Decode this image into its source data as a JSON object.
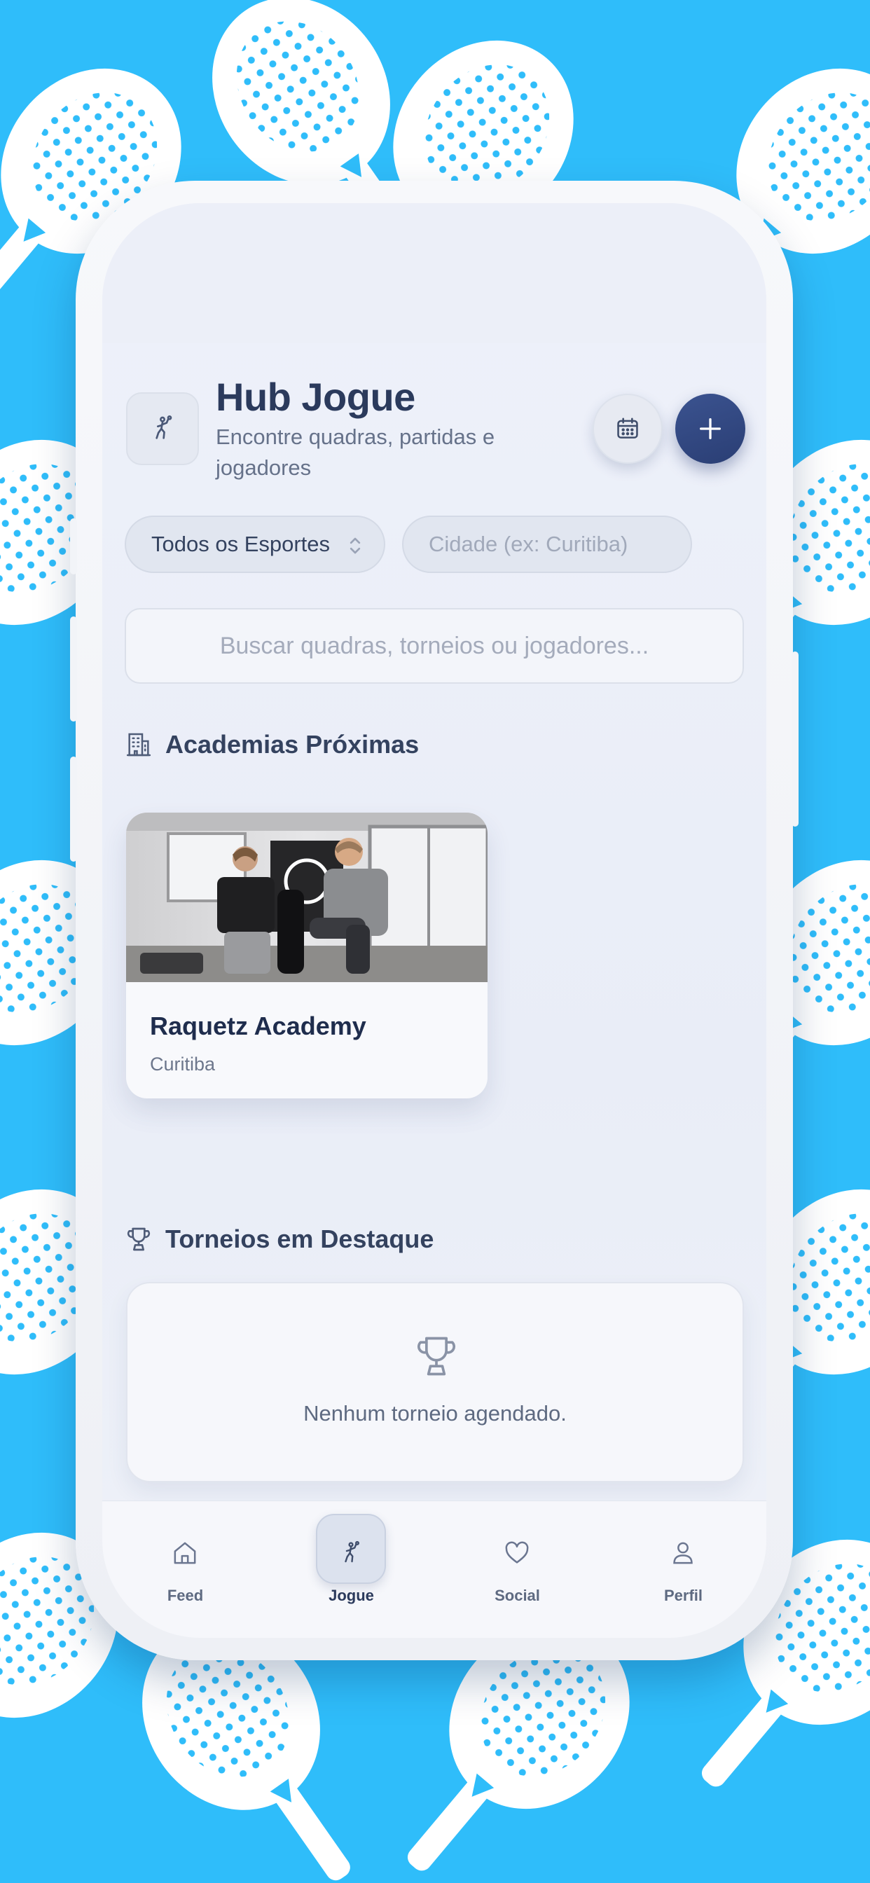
{
  "header": {
    "title": "Hub Jogue",
    "subtitle": "Encontre quadras, partidas e jogadores",
    "logo_icon": "tennis-player-icon",
    "calendar_icon": "calendar-icon",
    "add_icon": "plus-icon"
  },
  "filters": {
    "sport_label": "Todos os Esportes",
    "city_placeholder": "Cidade (ex: Curitiba)"
  },
  "search": {
    "placeholder": "Buscar quadras, torneios ou jogadores..."
  },
  "academies": {
    "title": "Academias Próximas",
    "items": [
      {
        "name": "Raquetz Academy",
        "city": "Curitiba"
      }
    ]
  },
  "tournaments": {
    "title": "Torneios em Destaque",
    "empty_text": "Nenhum torneio agendado."
  },
  "tabbar": {
    "items": [
      {
        "label": "Feed",
        "icon": "home-icon"
      },
      {
        "label": "Jogue",
        "icon": "tennis-player-icon",
        "active": true
      },
      {
        "label": "Social",
        "icon": "heart-icon"
      },
      {
        "label": "Perfil",
        "icon": "user-icon"
      }
    ]
  },
  "colors": {
    "background": "#2fbdfa",
    "accent": "#2f4680",
    "text_primary": "#2b3a5c"
  }
}
